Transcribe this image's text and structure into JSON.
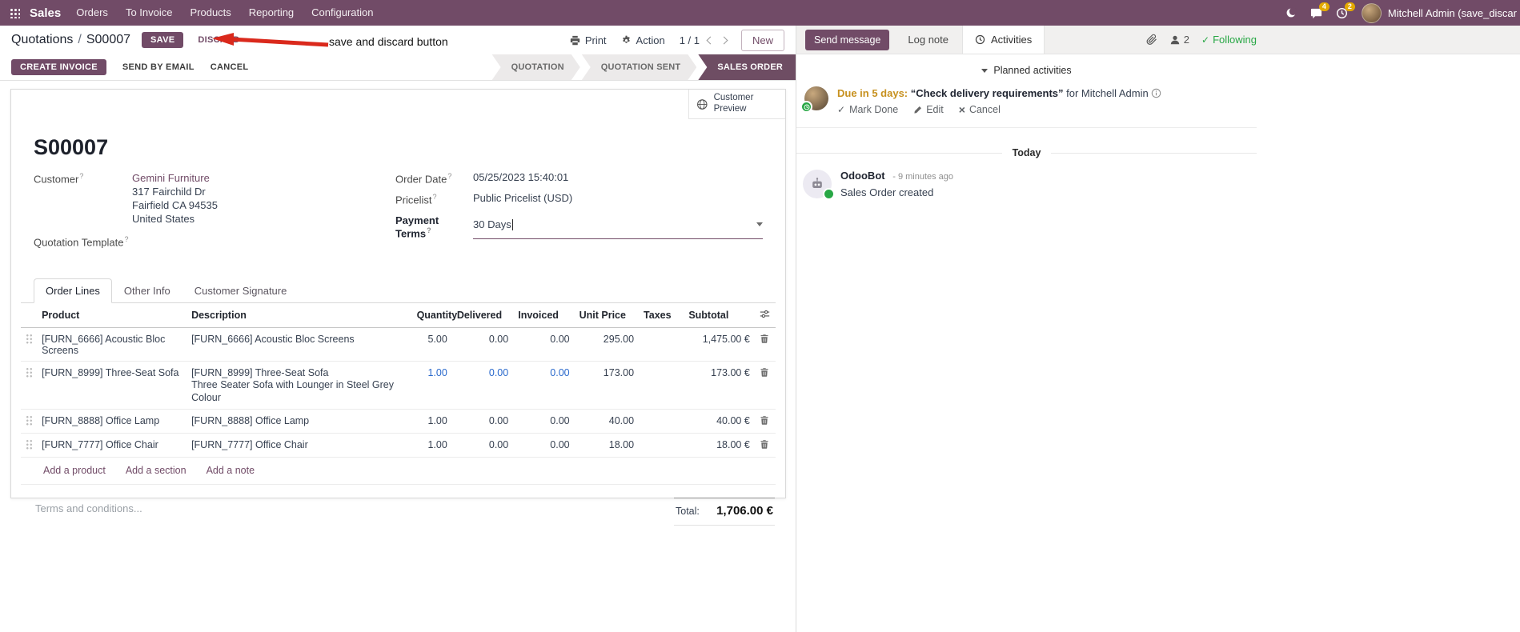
{
  "colors": {
    "brand": "#714B67",
    "active_step_bg": "#6e4d63",
    "dirty_field": "#2a69cc",
    "success_green": "#28a745",
    "activity_due_gold": "#c7911f",
    "annotation_red": "#da291c",
    "navbar_badge": "#e4a900"
  },
  "navbar": {
    "app_name": "Sales",
    "menus": [
      "Orders",
      "To Invoice",
      "Products",
      "Reporting",
      "Configuration"
    ],
    "message_badge": "4",
    "activity_badge": "2",
    "user_name": "Mitchell Admin (save_discar"
  },
  "control_panel": {
    "breadcrumb_parent": "Quotations",
    "breadcrumb_separator": "/",
    "breadcrumb_current": "S00007",
    "save_label": "SAVE",
    "discard_label": "DISCARD",
    "print_label": "Print",
    "action_label": "Action",
    "pager_value": "1 / 1",
    "new_label": "New"
  },
  "annotation": {
    "label": "save and discard button"
  },
  "statusbar": {
    "create_invoice_label": "CREATE INVOICE",
    "send_by_email_label": "SEND BY EMAIL",
    "cancel_label": "CANCEL",
    "steps": [
      "QUOTATION",
      "QUOTATION SENT",
      "SALES ORDER"
    ],
    "active_step": "SALES ORDER"
  },
  "sheet": {
    "customer_preview_label": "Customer Preview",
    "title": "S00007",
    "field_hint": "?",
    "fields": {
      "customer_label": "Customer",
      "customer_name": "Gemini Furniture",
      "customer_street": "317 Fairchild Dr",
      "customer_city": "Fairfield CA 94535",
      "customer_country": "United States",
      "quotation_template_label": "Quotation Template",
      "order_date_label": "Order Date",
      "order_date_value": "05/25/2023 15:40:01",
      "pricelist_label": "Pricelist",
      "pricelist_value": "Public Pricelist (USD)",
      "payment_terms_label": "Payment Terms",
      "payment_terms_value": "30 Days"
    },
    "tabs": [
      "Order Lines",
      "Other Info",
      "Customer Signature"
    ],
    "order_lines": {
      "headers": {
        "product": "Product",
        "description": "Description",
        "quantity": "Quantity",
        "delivered": "Delivered",
        "invoiced": "Invoiced",
        "unit_price": "Unit Price",
        "taxes": "Taxes",
        "subtotal": "Subtotal"
      },
      "rows": [
        {
          "product": "[FURN_6666] Acoustic Bloc Screens",
          "description": "[FURN_6666] Acoustic Bloc Screens",
          "description2": "",
          "quantity": "5.00",
          "delivered": "0.00",
          "invoiced": "0.00",
          "unit_price": "295.00",
          "taxes": "",
          "subtotal": "1,475.00 €"
        },
        {
          "product": "[FURN_8999] Three-Seat Sofa",
          "description": "[FURN_8999] Three-Seat Sofa",
          "description2": "Three Seater Sofa with Lounger in Steel Grey Colour",
          "quantity": "1.00",
          "delivered": "0.00",
          "invoiced": "0.00",
          "unit_price": "173.00",
          "taxes": "",
          "subtotal": "173.00 €"
        },
        {
          "product": "[FURN_8888] Office Lamp",
          "description": "[FURN_8888] Office Lamp",
          "description2": "",
          "quantity": "1.00",
          "delivered": "0.00",
          "invoiced": "0.00",
          "unit_price": "40.00",
          "taxes": "",
          "subtotal": "40.00 €"
        },
        {
          "product": "[FURN_7777] Office Chair",
          "description": "[FURN_7777] Office Chair",
          "description2": "",
          "quantity": "1.00",
          "delivered": "0.00",
          "invoiced": "0.00",
          "unit_price": "18.00",
          "taxes": "",
          "subtotal": "18.00 €"
        }
      ],
      "add_product_label": "Add a product",
      "add_section_label": "Add a section",
      "add_note_label": "Add a note"
    },
    "terms_placeholder": "Terms and conditions...",
    "total_label": "Total:",
    "total_value": "1,706.00 €"
  },
  "chatter": {
    "send_message_label": "Send message",
    "log_note_label": "Log note",
    "activities_tab_label": "Activities",
    "followers_count": "2",
    "following_label": "Following",
    "following_check": "✓",
    "planned_activities_label": "Planned activities",
    "activity": {
      "due_text": "Due in 5 days:",
      "summary": "“Check delivery requirements”",
      "assignee": "for Mitchell Admin",
      "mark_done_check": "✓",
      "mark_done_label": "Mark Done",
      "edit_label": "Edit",
      "cancel_x": "×",
      "cancel_label": "Cancel"
    },
    "date_divider": "Today",
    "message": {
      "author": "OdooBot",
      "time": "- 9 minutes ago",
      "body": "Sales Order created"
    }
  }
}
